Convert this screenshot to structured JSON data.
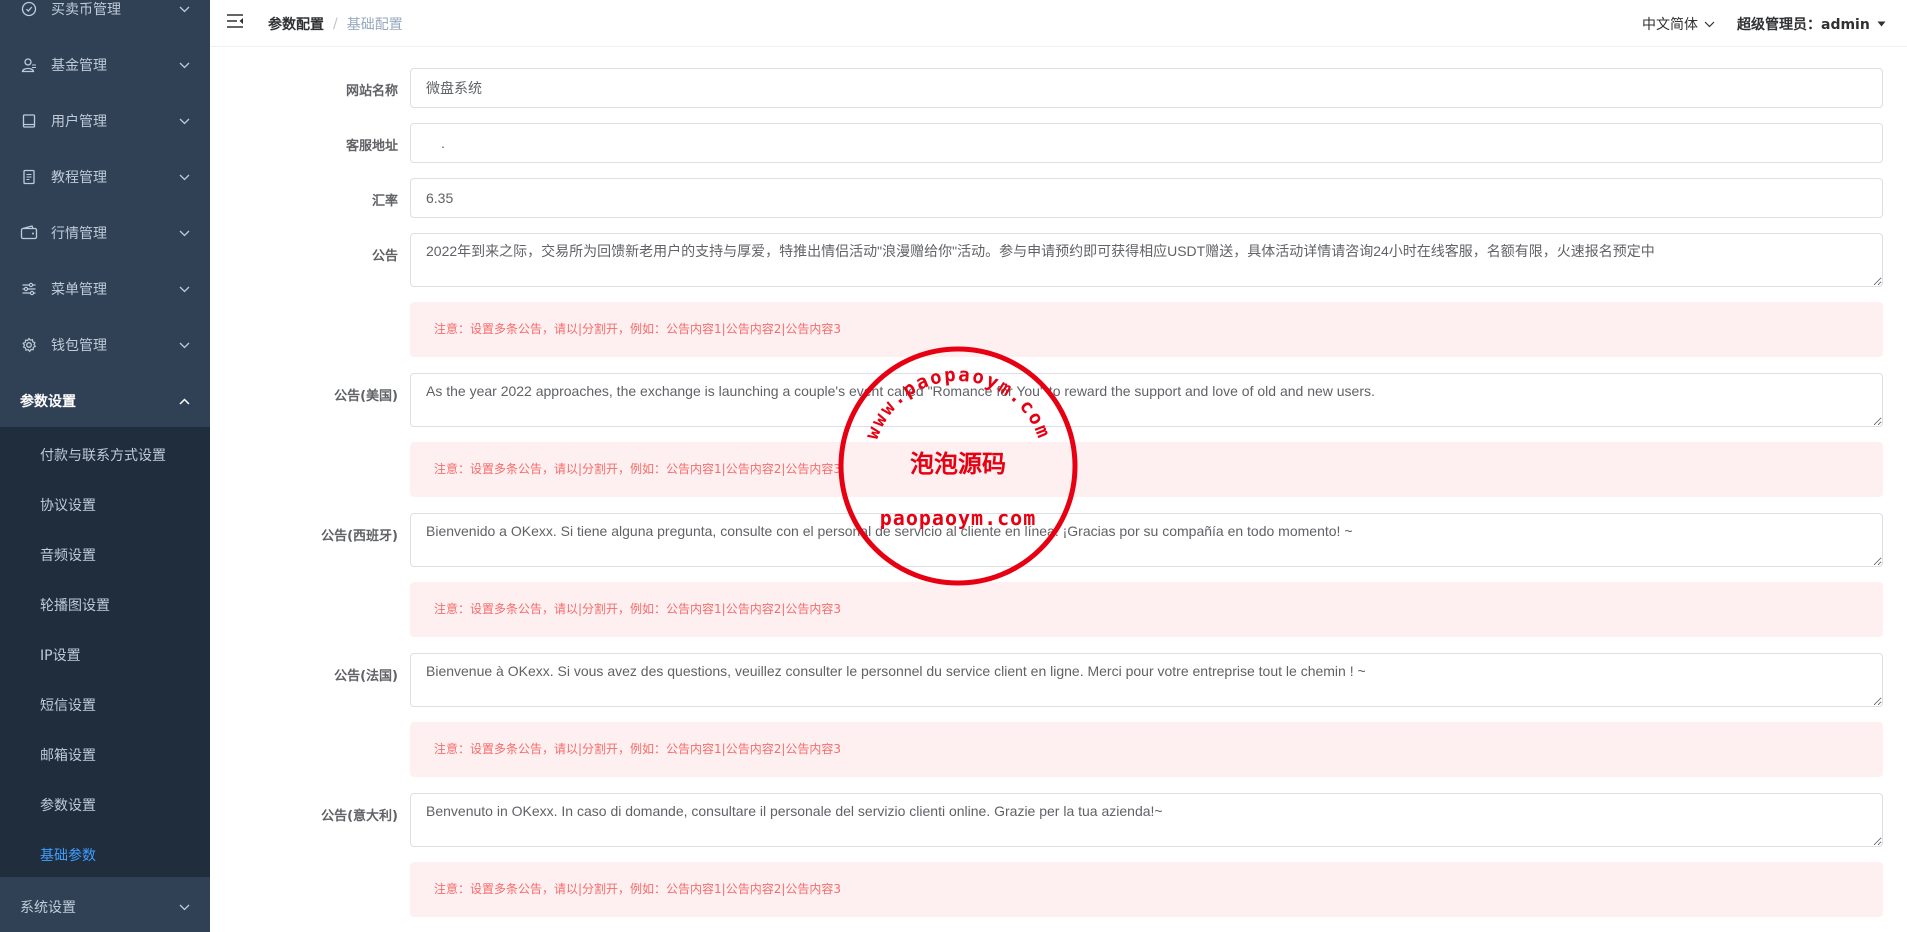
{
  "sidebar": {
    "menus": [
      {
        "label": "买卖币管理",
        "icon": "coin-icon"
      },
      {
        "label": "基金管理",
        "icon": "user-icon"
      },
      {
        "label": "用户管理",
        "icon": "book-icon"
      },
      {
        "label": "教程管理",
        "icon": "document-icon"
      },
      {
        "label": "行情管理",
        "icon": "wallet-icon"
      },
      {
        "label": "菜单管理",
        "icon": "sliders-icon"
      },
      {
        "label": "钱包管理",
        "icon": "gear-icon"
      }
    ],
    "open_menu": {
      "label": "参数设置"
    },
    "sub_items": [
      {
        "label": "付款与联系方式设置"
      },
      {
        "label": "协议设置"
      },
      {
        "label": "音频设置"
      },
      {
        "label": "轮播图设置"
      },
      {
        "label": "IP设置"
      },
      {
        "label": "短信设置"
      },
      {
        "label": "邮箱设置"
      },
      {
        "label": "参数设置"
      },
      {
        "label": "基础参数"
      }
    ],
    "last_menu": {
      "label": "系统设置"
    }
  },
  "header": {
    "breadcrumb": {
      "first": "参数配置",
      "separator": "/",
      "current": "基础配置"
    },
    "language": "中文简体",
    "user": "超级管理员：admin"
  },
  "form": {
    "site_name": {
      "label": "网站名称",
      "value": "微盘系统"
    },
    "service_url": {
      "label": "客服地址",
      "value": "."
    },
    "exchange_rate": {
      "label": "汇率",
      "value": "6.35"
    },
    "announcements": [
      {
        "label": "公告",
        "value": "2022年到来之际，交易所为回馈新老用户的支持与厚爱，特推出情侣活动\"浪漫赠给你\"活动。参与申请预约即可获得相应USDT赠送，具体活动详情请咨询24小时在线客服，名额有限，火速报名预定中"
      },
      {
        "label": "公告(美国)",
        "value": "As the year 2022 approaches, the exchange is launching a couple's event called \"Romance for You\" to reward the support and love of old and new users."
      },
      {
        "label": "公告(西班牙)",
        "value": "Bienvenido a OKexx. Si tiene alguna pregunta, consulte con el personal de servicio al cliente en línea. ¡Gracias por su compañía en todo momento! ~"
      },
      {
        "label": "公告(法国)",
        "value": "Bienvenue à OKexx. Si vous avez des questions, veuillez consulter le personnel du service client en ligne. Merci pour votre entreprise tout le chemin ! ~"
      },
      {
        "label": "公告(意大利)",
        "value": "Benvenuto in OKexx. In caso di domande, consultare il personale del servizio clienti online. Grazie per la tua azienda!~"
      }
    ],
    "notice_text": "注意：设置多条公告，请以|分割开，例如：公告内容1|公告内容2|公告内容3"
  },
  "watermark": {
    "arc_text": "www.paopaoym.com",
    "center_text": "泡泡源码",
    "bottom_text": "paopaoym.com"
  },
  "colors": {
    "sidebar_bg": "#304156",
    "submenu_bg": "#1f2d3d",
    "active": "#409eff",
    "notice_bg": "#fef0f0",
    "notice_text": "#f56c6c",
    "stamp": "#e60012"
  }
}
